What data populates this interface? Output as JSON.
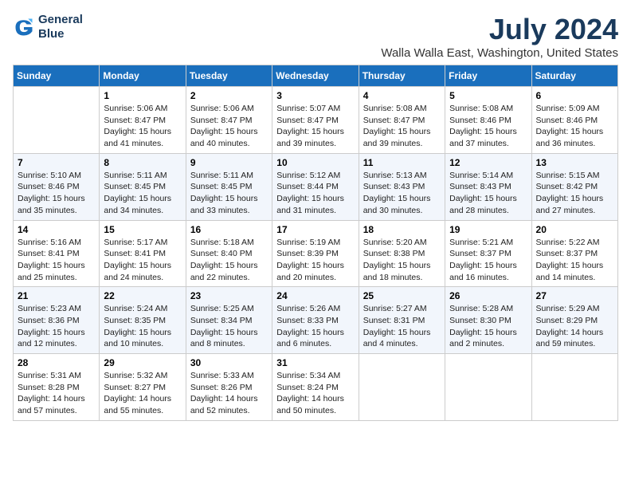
{
  "logo": {
    "line1": "General",
    "line2": "Blue"
  },
  "title": "July 2024",
  "location": "Walla Walla East, Washington, United States",
  "days": [
    "Sunday",
    "Monday",
    "Tuesday",
    "Wednesday",
    "Thursday",
    "Friday",
    "Saturday"
  ],
  "weeks": [
    [
      {
        "date": "",
        "info": ""
      },
      {
        "date": "1",
        "info": "Sunrise: 5:06 AM\nSunset: 8:47 PM\nDaylight: 15 hours\nand 41 minutes."
      },
      {
        "date": "2",
        "info": "Sunrise: 5:06 AM\nSunset: 8:47 PM\nDaylight: 15 hours\nand 40 minutes."
      },
      {
        "date": "3",
        "info": "Sunrise: 5:07 AM\nSunset: 8:47 PM\nDaylight: 15 hours\nand 39 minutes."
      },
      {
        "date": "4",
        "info": "Sunrise: 5:08 AM\nSunset: 8:47 PM\nDaylight: 15 hours\nand 39 minutes."
      },
      {
        "date": "5",
        "info": "Sunrise: 5:08 AM\nSunset: 8:46 PM\nDaylight: 15 hours\nand 37 minutes."
      },
      {
        "date": "6",
        "info": "Sunrise: 5:09 AM\nSunset: 8:46 PM\nDaylight: 15 hours\nand 36 minutes."
      }
    ],
    [
      {
        "date": "7",
        "info": "Sunrise: 5:10 AM\nSunset: 8:46 PM\nDaylight: 15 hours\nand 35 minutes."
      },
      {
        "date": "8",
        "info": "Sunrise: 5:11 AM\nSunset: 8:45 PM\nDaylight: 15 hours\nand 34 minutes."
      },
      {
        "date": "9",
        "info": "Sunrise: 5:11 AM\nSunset: 8:45 PM\nDaylight: 15 hours\nand 33 minutes."
      },
      {
        "date": "10",
        "info": "Sunrise: 5:12 AM\nSunset: 8:44 PM\nDaylight: 15 hours\nand 31 minutes."
      },
      {
        "date": "11",
        "info": "Sunrise: 5:13 AM\nSunset: 8:43 PM\nDaylight: 15 hours\nand 30 minutes."
      },
      {
        "date": "12",
        "info": "Sunrise: 5:14 AM\nSunset: 8:43 PM\nDaylight: 15 hours\nand 28 minutes."
      },
      {
        "date": "13",
        "info": "Sunrise: 5:15 AM\nSunset: 8:42 PM\nDaylight: 15 hours\nand 27 minutes."
      }
    ],
    [
      {
        "date": "14",
        "info": "Sunrise: 5:16 AM\nSunset: 8:41 PM\nDaylight: 15 hours\nand 25 minutes."
      },
      {
        "date": "15",
        "info": "Sunrise: 5:17 AM\nSunset: 8:41 PM\nDaylight: 15 hours\nand 24 minutes."
      },
      {
        "date": "16",
        "info": "Sunrise: 5:18 AM\nSunset: 8:40 PM\nDaylight: 15 hours\nand 22 minutes."
      },
      {
        "date": "17",
        "info": "Sunrise: 5:19 AM\nSunset: 8:39 PM\nDaylight: 15 hours\nand 20 minutes."
      },
      {
        "date": "18",
        "info": "Sunrise: 5:20 AM\nSunset: 8:38 PM\nDaylight: 15 hours\nand 18 minutes."
      },
      {
        "date": "19",
        "info": "Sunrise: 5:21 AM\nSunset: 8:37 PM\nDaylight: 15 hours\nand 16 minutes."
      },
      {
        "date": "20",
        "info": "Sunrise: 5:22 AM\nSunset: 8:37 PM\nDaylight: 15 hours\nand 14 minutes."
      }
    ],
    [
      {
        "date": "21",
        "info": "Sunrise: 5:23 AM\nSunset: 8:36 PM\nDaylight: 15 hours\nand 12 minutes."
      },
      {
        "date": "22",
        "info": "Sunrise: 5:24 AM\nSunset: 8:35 PM\nDaylight: 15 hours\nand 10 minutes."
      },
      {
        "date": "23",
        "info": "Sunrise: 5:25 AM\nSunset: 8:34 PM\nDaylight: 15 hours\nand 8 minutes."
      },
      {
        "date": "24",
        "info": "Sunrise: 5:26 AM\nSunset: 8:33 PM\nDaylight: 15 hours\nand 6 minutes."
      },
      {
        "date": "25",
        "info": "Sunrise: 5:27 AM\nSunset: 8:31 PM\nDaylight: 15 hours\nand 4 minutes."
      },
      {
        "date": "26",
        "info": "Sunrise: 5:28 AM\nSunset: 8:30 PM\nDaylight: 15 hours\nand 2 minutes."
      },
      {
        "date": "27",
        "info": "Sunrise: 5:29 AM\nSunset: 8:29 PM\nDaylight: 14 hours\nand 59 minutes."
      }
    ],
    [
      {
        "date": "28",
        "info": "Sunrise: 5:31 AM\nSunset: 8:28 PM\nDaylight: 14 hours\nand 57 minutes."
      },
      {
        "date": "29",
        "info": "Sunrise: 5:32 AM\nSunset: 8:27 PM\nDaylight: 14 hours\nand 55 minutes."
      },
      {
        "date": "30",
        "info": "Sunrise: 5:33 AM\nSunset: 8:26 PM\nDaylight: 14 hours\nand 52 minutes."
      },
      {
        "date": "31",
        "info": "Sunrise: 5:34 AM\nSunset: 8:24 PM\nDaylight: 14 hours\nand 50 minutes."
      },
      {
        "date": "",
        "info": ""
      },
      {
        "date": "",
        "info": ""
      },
      {
        "date": "",
        "info": ""
      }
    ]
  ]
}
